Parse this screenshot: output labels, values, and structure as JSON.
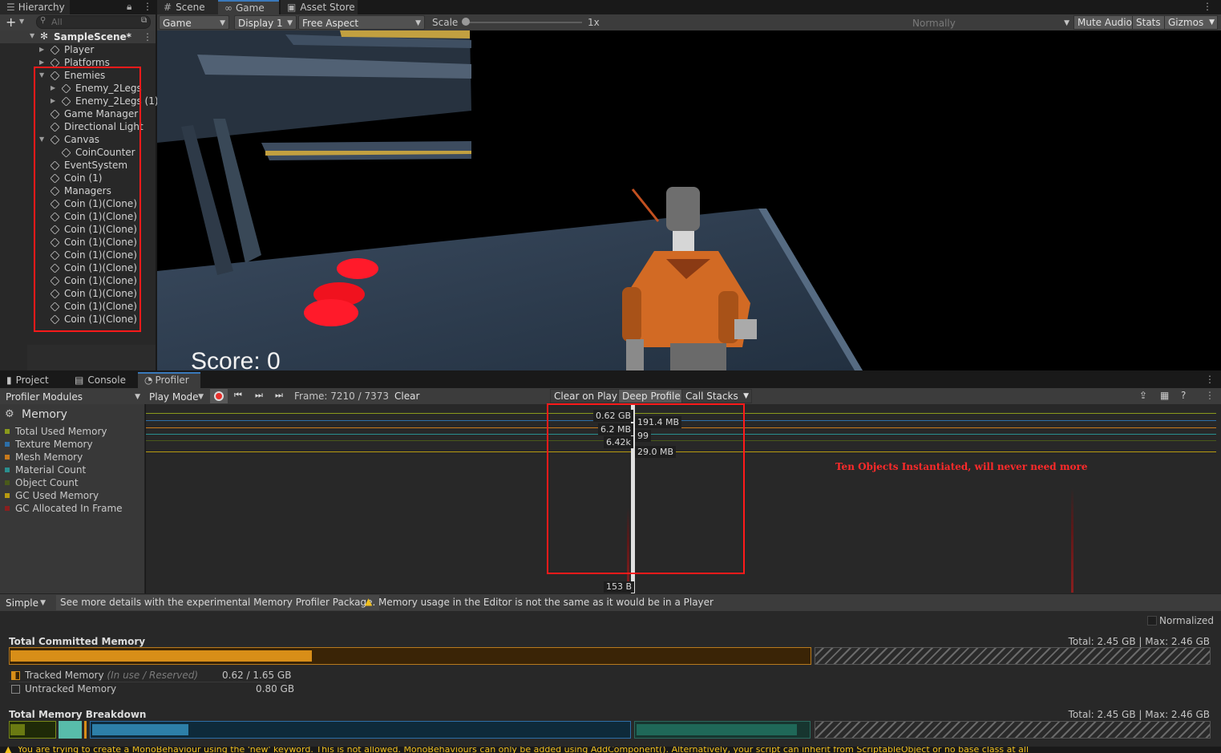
{
  "hierarchy": {
    "tab": "Hierarchy",
    "add": "+",
    "search_placeholder": "All",
    "scene": "SampleScene*",
    "items": [
      {
        "label": "Player",
        "depth": 1,
        "fold": "closed"
      },
      {
        "label": "Platforms",
        "depth": 1,
        "fold": "closed"
      },
      {
        "label": "Enemies",
        "depth": 1,
        "fold": "open"
      },
      {
        "label": "Enemy_2Legs",
        "depth": 2,
        "fold": "closed"
      },
      {
        "label": "Enemy_2Legs (1)",
        "depth": 2,
        "fold": "closed"
      },
      {
        "label": "Game Manager",
        "depth": 1,
        "fold": "none"
      },
      {
        "label": "Directional Light",
        "depth": 1,
        "fold": "none"
      },
      {
        "label": "Canvas",
        "depth": 1,
        "fold": "open"
      },
      {
        "label": "CoinCounter",
        "depth": 2,
        "fold": "none"
      },
      {
        "label": "EventSystem",
        "depth": 1,
        "fold": "none"
      },
      {
        "label": "Coin (1)",
        "depth": 1,
        "fold": "none"
      },
      {
        "label": "Managers",
        "depth": 1,
        "fold": "none"
      },
      {
        "label": "Coin (1)(Clone)",
        "depth": 1,
        "fold": "none"
      },
      {
        "label": "Coin (1)(Clone)",
        "depth": 1,
        "fold": "none"
      },
      {
        "label": "Coin (1)(Clone)",
        "depth": 1,
        "fold": "none"
      },
      {
        "label": "Coin (1)(Clone)",
        "depth": 1,
        "fold": "none"
      },
      {
        "label": "Coin (1)(Clone)",
        "depth": 1,
        "fold": "none"
      },
      {
        "label": "Coin (1)(Clone)",
        "depth": 1,
        "fold": "none"
      },
      {
        "label": "Coin (1)(Clone)",
        "depth": 1,
        "fold": "none"
      },
      {
        "label": "Coin (1)(Clone)",
        "depth": 1,
        "fold": "none"
      },
      {
        "label": "Coin (1)(Clone)",
        "depth": 1,
        "fold": "none"
      },
      {
        "label": "Coin (1)(Clone)",
        "depth": 1,
        "fold": "none"
      }
    ]
  },
  "top_tabs": {
    "scene": "Scene",
    "game": "Game",
    "asset_store": "Asset Store"
  },
  "game_toolbar": {
    "mode": "Game",
    "display": "Display 1",
    "aspect": "Free Aspect",
    "scale_label": "Scale",
    "scale_value": "1x",
    "maximize": "Normally",
    "mute": "Mute Audio",
    "stats": "Stats",
    "gizmos": "Gizmos"
  },
  "game_view": {
    "score": "Score: 0"
  },
  "bottom_tabs": {
    "project": "Project",
    "console": "Console",
    "profiler": "Profiler"
  },
  "profiler_toolbar": {
    "modules": "Profiler Modules",
    "play_mode": "Play Mode",
    "frame": "Frame: 7210 / 7373",
    "clear": "Clear",
    "clear_on_play": "Clear on Play",
    "deep_profile": "Deep Profile",
    "call_stacks": "Call Stacks"
  },
  "memory_module": {
    "title": "Memory",
    "legend": [
      {
        "label": "Total Used Memory",
        "color": "#8a9a1c"
      },
      {
        "label": "Texture Memory",
        "color": "#2d6fa8"
      },
      {
        "label": "Mesh Memory",
        "color": "#c87a1c"
      },
      {
        "label": "Material Count",
        "color": "#2a8f8f"
      },
      {
        "label": "Object Count",
        "color": "#4a5a1a"
      },
      {
        "label": "GC Used Memory",
        "color": "#b89a10"
      },
      {
        "label": "GC Allocated In Frame",
        "color": "#8a1f1f"
      }
    ],
    "values": {
      "total_used": "0.62 GB",
      "texture": "191.4 MB",
      "mesh": "6.2 MB",
      "material_count": "99",
      "object_count": "6.42k",
      "gc_used": "29.0 MB",
      "gc_alloc": "153 B"
    },
    "annotation": "Ten Objects Instantiated, will never need more"
  },
  "details": {
    "view_mode": "Simple",
    "memory_profiler_link": "See more details with the experimental Memory Profiler Package.",
    "warning": "Memory usage in the Editor is not the same as it would be in a Player",
    "normalized": "Normalized",
    "committed_title": "Total Committed Memory",
    "committed_total": "Total: 2.45 GB | Max: 2.46 GB",
    "tracked_label": "Tracked Memory",
    "tracked_sub": "(In use / Reserved)",
    "tracked_value": "0.62 / 1.65 GB",
    "untracked_label": "Untracked Memory",
    "untracked_value": "0.80 GB",
    "breakdown_title": "Total Memory Breakdown",
    "breakdown_total": "Total: 2.45 GB | Max: 2.46 GB",
    "committed_used_fraction": 0.376
  },
  "status_bar": {
    "message": "You are trying to create a MonoBehaviour using the 'new' keyword.  This is not allowed.  MonoBehaviours can only be added using AddComponent(). Alternatively, your script can inherit from ScriptableObject or no base class at all"
  }
}
